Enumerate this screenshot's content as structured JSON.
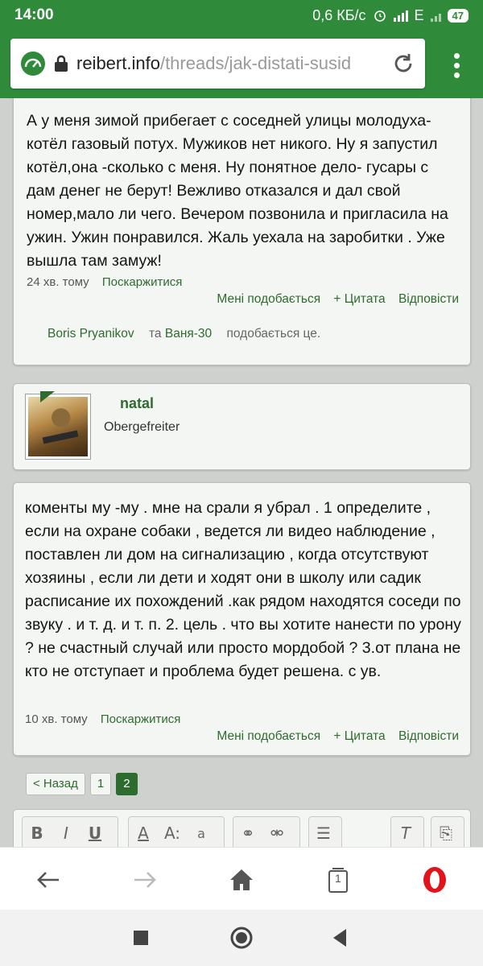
{
  "status": {
    "time": "14:00",
    "speed": "0,6 КБ/с",
    "network": "E",
    "battery": "47"
  },
  "browser": {
    "url_domain": "reibert.info",
    "url_path": "/threads/jak-distati-susid"
  },
  "posts": [
    {
      "text": "А у меня зимой прибегает с соседней улицы молодуха- котёл газовый потух. Мужиков нет никого. Ну я запустил котёл,она -сколько с меня. Ну понятное дело- гусары с дам денег не берут! Вежливо отказался и дал свой номер,мало ли чего. Вечером позвонила и пригласила на ужин. Ужин понравился. Жаль уехала на заробитки . Уже вышла там замуж!",
      "time": "24 хв. тому",
      "report": "Поскаржитися",
      "like": "Мені подобається",
      "quote": "+ Цитата",
      "reply": "Відповісти",
      "liker1": "Boris Pryanikov",
      "and": "та",
      "liker2": "Ваня-30",
      "likes_suffix": "подобається це."
    },
    {
      "text": "коменты му -му . мне на срали я убрал . 1 определите , если на охране собаки , ведется ли видео наблюдение , поставлен ли дом на сигнализацию , когда отсутствуют хозяины , если ли дети и ходят они в школу или садик расписание их похождений .как рядом находятся соседи по звуку . и т. д. и т. п. 2. цель . что вы хотите нанести по урону ? не счастный случай или просто мордобой ? 3.от плана не кто не отступает и проблема будет решена. с ув.",
      "time": "10 хв. тому",
      "report": "Поскаржитися",
      "like": "Мені подобається",
      "quote": "+ Цитата",
      "reply": "Відповісти"
    }
  ],
  "author": {
    "name": "natal",
    "rank": "Obergefreiter"
  },
  "pagination": {
    "prev": "< Назад",
    "page1": "1",
    "page2": "2"
  },
  "editor": {
    "bold": "B",
    "italic": "I",
    "underline": "U",
    "font_color": "A",
    "font_size": "A:",
    "font_family": "a",
    "tab_count": "1"
  },
  "colors": {
    "brand_green": "#2f8a3a",
    "link_green": "#2e6b2e",
    "opera_red": "#e3131b"
  }
}
